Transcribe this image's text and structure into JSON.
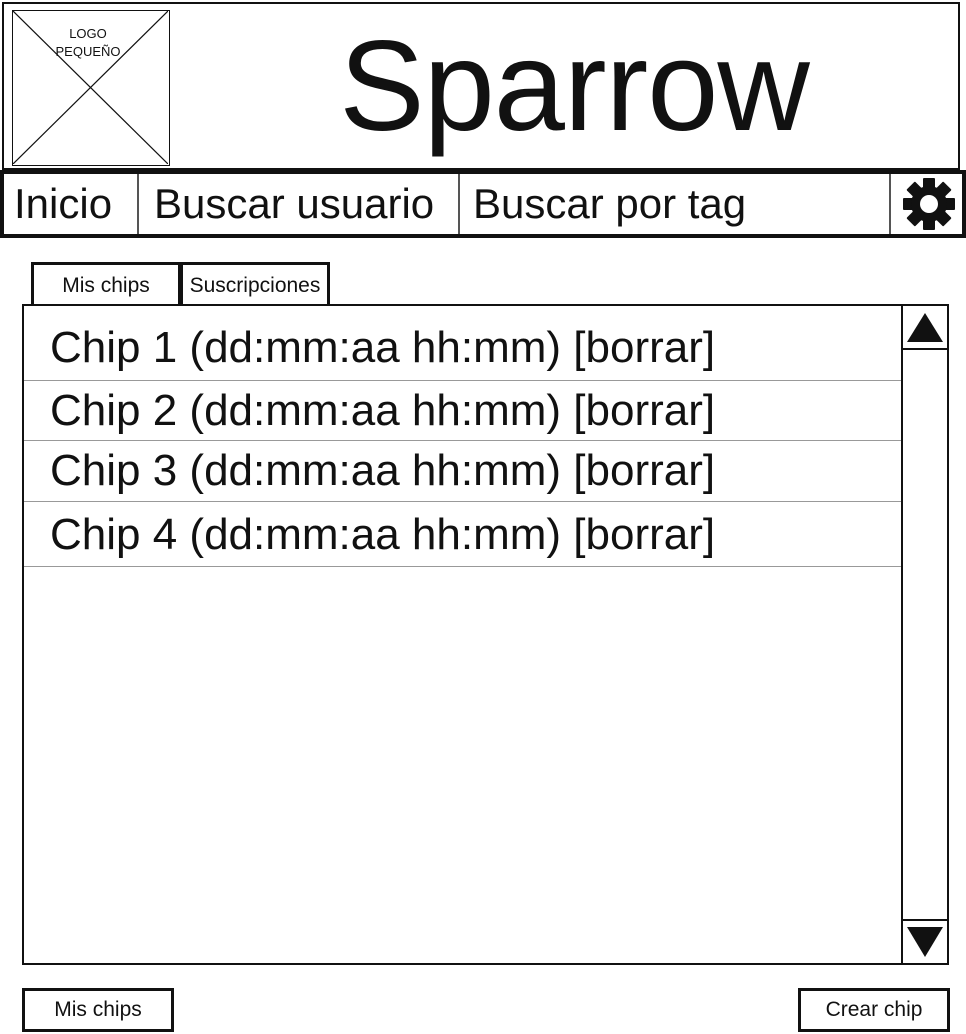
{
  "header": {
    "logo_text": "LOGO\nPEQUEÑO",
    "title": "Sparrow"
  },
  "nav": {
    "items": [
      {
        "label": "Inicio"
      },
      {
        "label": "Buscar usuario"
      },
      {
        "label": "Buscar por tag"
      }
    ],
    "settings_icon": "gear-icon"
  },
  "tabs": [
    {
      "label": "Mis chips"
    },
    {
      "label": "Suscripciones"
    }
  ],
  "chips": [
    {
      "label": "Chip 1 (dd:mm:aa  hh:mm) [borrar]"
    },
    {
      "label": "Chip 2 (dd:mm:aa  hh:mm) [borrar]"
    },
    {
      "label": "Chip 3 (dd:mm:aa  hh:mm) [borrar]"
    },
    {
      "label": "Chip 4 (dd:mm:aa  hh:mm) [borrar]"
    }
  ],
  "scroll": {
    "up_icon": "triangle-up-icon",
    "down_icon": "triangle-down-icon"
  },
  "footer": {
    "left_button": "Mis chips",
    "right_button": "Crear chip"
  }
}
